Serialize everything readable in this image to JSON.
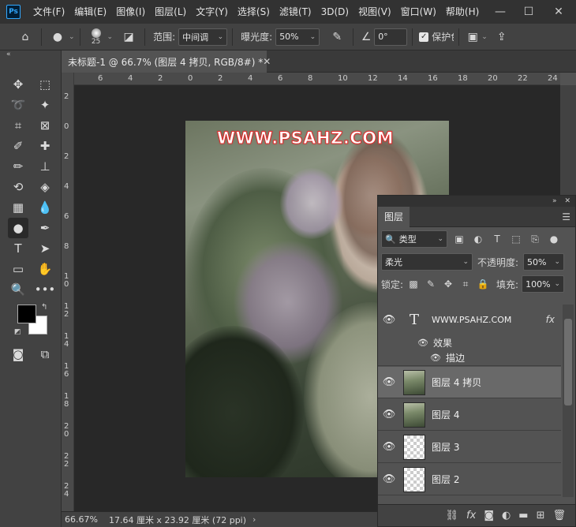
{
  "menubar": {
    "logo": "Ps",
    "items": [
      "文件(F)",
      "编辑(E)",
      "图像(I)",
      "图层(L)",
      "文字(Y)",
      "选择(S)",
      "滤镜(T)",
      "3D(D)",
      "视图(V)",
      "窗口(W)",
      "帮助(H)"
    ],
    "controls": {
      "minimize": "—",
      "maximize": "☐",
      "close": "✕"
    }
  },
  "options": {
    "brush_size": "25",
    "range_label": "范围:",
    "range_value": "中间调",
    "exposure_label": "曝光度:",
    "exposure_value": "50%",
    "angle_value": "0°",
    "protect_label": "保护色"
  },
  "document": {
    "tab_title": "未标题-1 @ 66.7% (图层 4 拷贝, RGB/8#) *",
    "watermark": "WWW.PSAHZ.COM"
  },
  "ruler": {
    "top": [
      "6",
      "4",
      "2",
      "0",
      "2",
      "4",
      "6",
      "8",
      "10",
      "12",
      "14",
      "16",
      "18",
      "20",
      "22",
      "24"
    ],
    "left": [
      "2",
      "0",
      "2",
      "4",
      "6",
      "8",
      "10",
      "12",
      "14",
      "16",
      "18",
      "20",
      "22",
      "24"
    ]
  },
  "status": {
    "zoom": "66.67%",
    "info": "17.64 厘米 x 23.92 厘米 (72 ppi)"
  },
  "layers_panel": {
    "tab": "图层",
    "filter_label": "类型",
    "blend_mode": "柔光",
    "opacity_label": "不透明度:",
    "opacity_value": "50%",
    "lock_label": "锁定:",
    "fill_label": "填充:",
    "fill_value": "100%",
    "effects_label": "效果",
    "stroke_label": "描边",
    "fx_label": "fx",
    "layers": [
      {
        "name": "WWW.PSAHZ.COM",
        "type": "text"
      },
      {
        "name": "图层 4 拷贝",
        "type": "photo",
        "selected": true
      },
      {
        "name": "图层 4",
        "type": "photo"
      },
      {
        "name": "图层 3",
        "type": "transparent"
      },
      {
        "name": "图层 2",
        "type": "transparent"
      }
    ]
  }
}
